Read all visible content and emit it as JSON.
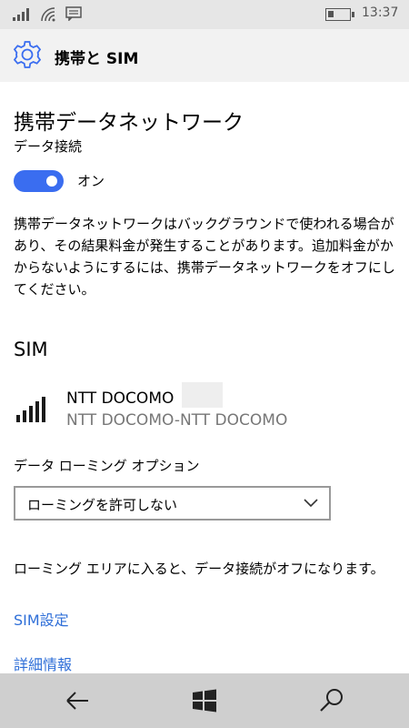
{
  "status_bar": {
    "time": "13:37",
    "icons": [
      "signal-icon",
      "wifi-icon",
      "message-icon",
      "battery-icon"
    ]
  },
  "header": {
    "title": "携帯と SIM",
    "icon": "gear-icon"
  },
  "cellular": {
    "heading": "携帯データネットワーク",
    "data_connection_label": "データ接続",
    "toggle_state": "オン",
    "toggle_on": true,
    "description": "携帯データネットワークはバックグラウンドで使われる場合があり、その結果料金が発生することがあります。追加料金がかからないようにするには、携帯データネットワークをオフにしてください。"
  },
  "sim": {
    "heading": "SIM",
    "name": "NTT DOCOMO",
    "carrier": "NTT DOCOMO-NTT DOCOMO",
    "signal_icon": "signal-strength-icon"
  },
  "roaming": {
    "label": "データ ローミング オプション",
    "selected": "ローミングを許可しない",
    "note": "ローミング エリアに入ると、データ接続がオフになります。"
  },
  "links": {
    "sim_settings": "SIM設定",
    "details": "詳細情報"
  },
  "nav": {
    "back_icon": "back-arrow-icon",
    "start_icon": "windows-logo-icon",
    "search_icon": "search-icon"
  },
  "colors": {
    "accent": "#3a6df0",
    "link": "#2f6fd8",
    "nav_bg": "#cfcfcf",
    "title_bg": "#f2f2f2"
  }
}
